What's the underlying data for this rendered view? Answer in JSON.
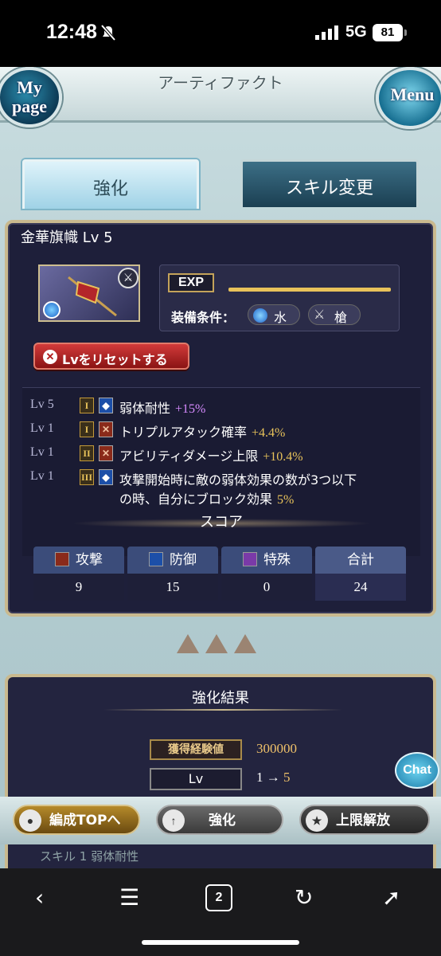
{
  "status_bar": {
    "time": "12:48",
    "network": "5G",
    "battery": "81"
  },
  "header": {
    "title": "アーティファクト",
    "mypage": "My page",
    "menu": "Menu"
  },
  "tabs": [
    {
      "label": "強化",
      "active": true
    },
    {
      "label": "スキル変更",
      "active": false
    }
  ],
  "artifact": {
    "name": "金華旗幟 Lv 5",
    "exp_label": "EXP",
    "exp_progress": 1.0,
    "conditions_label": "装備条件：",
    "element": "水",
    "weapon": "槍",
    "reset_button": "Lvをリセットする"
  },
  "skills": [
    {
      "lv": "Lv 5",
      "rank": "I",
      "type": "defense",
      "name": "弱体耐性",
      "value": "+15%",
      "value_color": "#d78bff"
    },
    {
      "lv": "Lv 1",
      "rank": "I",
      "type": "attack",
      "name": "トリプルアタック確率",
      "value": "+4.4%"
    },
    {
      "lv": "Lv 1",
      "rank": "II",
      "type": "attack",
      "name": "アビリティダメージ上限",
      "value": "+10.4%"
    },
    {
      "lv": "Lv 1",
      "rank": "III",
      "type": "defense",
      "name": "攻撃開始時に敵の弱体効果の数が3つ以下",
      "name2": "の時、自分にブロック効果",
      "value": "5%"
    }
  ],
  "score": {
    "title": "スコア",
    "columns": [
      {
        "label": "攻撃",
        "value": "9",
        "icon": "attack-icon"
      },
      {
        "label": "防御",
        "value": "15",
        "icon": "defense-icon"
      },
      {
        "label": "特殊",
        "value": "0",
        "icon": "star-icon"
      },
      {
        "label": "合計",
        "value": "24",
        "icon": ""
      }
    ]
  },
  "results": {
    "title": "強化結果",
    "exp_key": "獲得経験値",
    "exp_value": "300000",
    "lv_key": "Lv",
    "lv_from": "1 →",
    "lv_to": "5"
  },
  "chat": "Chat",
  "buttons": {
    "formation": "編成TOPへ",
    "enhance": "強化",
    "limit": "上限解放"
  },
  "faded_text": "スキル 1   弱体耐性",
  "browser_nav": {
    "tab_count": "2"
  },
  "colors": {
    "gold": "#e8c25a",
    "panel": "#1e1f3a",
    "reset": "#c42a2a"
  }
}
